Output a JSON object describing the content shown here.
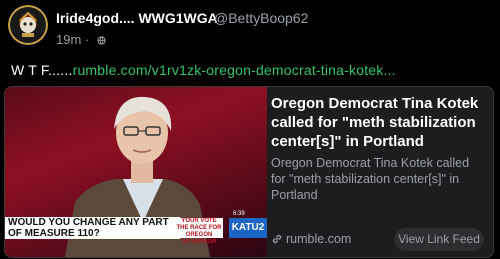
{
  "post": {
    "display_name": "Iride4god.... WWG1WGA",
    "handle": "@BettyBoop62",
    "age": "19m",
    "separator": "·",
    "text_prefix": "W T F......",
    "link_text": "rumble.com/v1rv1zk-oregon-democrat-tina-kotek..."
  },
  "card": {
    "title": "Oregon Democrat Tina Kotek called for \"meth stabilization center[s]\" in Portland",
    "description": "Oregon Democrat Tina Kotek called for \"meth stabilization center[s]\" in Portland",
    "source": "rumble.com",
    "action_label": "View Link Feed",
    "thumbnail": {
      "ticker": "WOULD YOU CHANGE ANY PART OF MEASURE 110?",
      "tag_line1": "YOUR VOTE",
      "tag_line2": "THE RACE FOR OREGON GOVERNOR",
      "network": "KATU2",
      "clock": "6:39"
    }
  },
  "icons": [
    "avatar-icon",
    "globe-icon",
    "link-icon"
  ],
  "colors": {
    "link": "#35c46a",
    "background": "#000000",
    "card": "#1d1d1f",
    "muted": "#9aa0a6"
  }
}
